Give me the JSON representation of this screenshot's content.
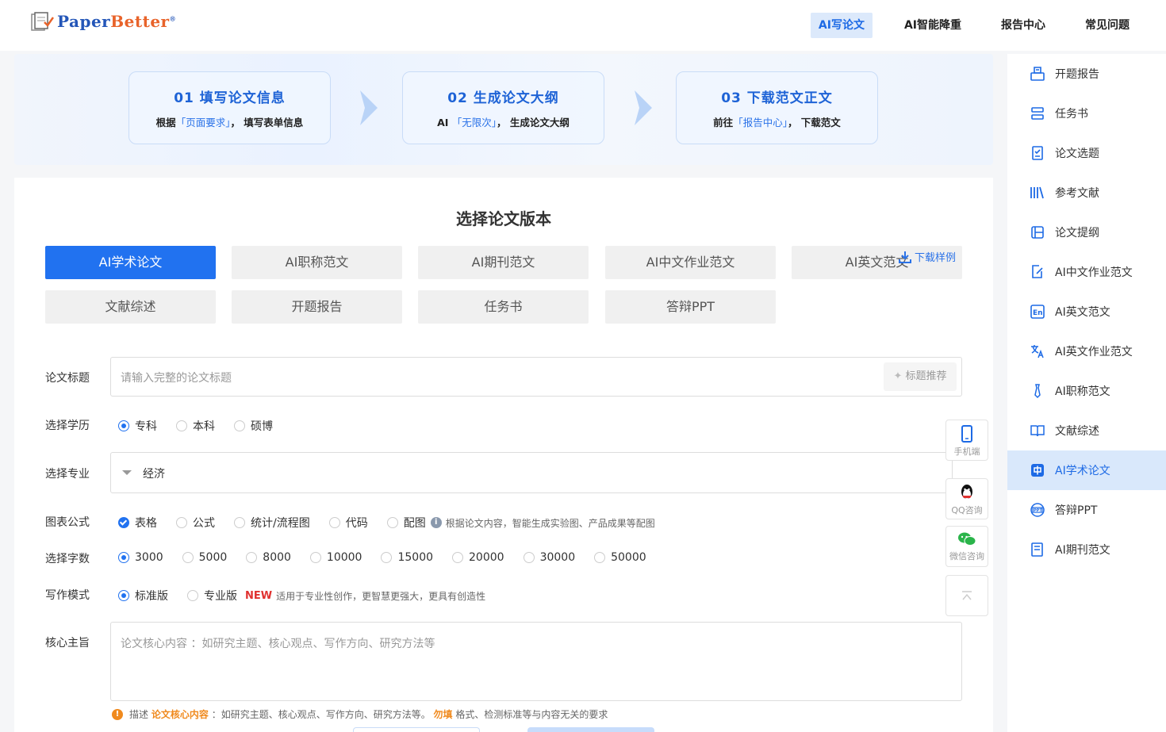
{
  "brand": {
    "name_a": "Paper",
    "name_b": "Better",
    "mark": "®"
  },
  "nav": [
    "AI写论文",
    "AI智能降重",
    "报告中心",
    "常见问题"
  ],
  "steps": [
    {
      "title": "01  填写论文信息",
      "pre": "根据",
      "hl": "「页面要求」",
      "post": "，  填写表单信息"
    },
    {
      "title": "02  生成论文大纲",
      "pre": "AI ",
      "hl": "「无限次」",
      "post": "，  生成论文大纲"
    },
    {
      "title": "03  下载范文正文",
      "pre": "前往",
      "hl": "「报告中心」",
      "post": "，  下载范文"
    }
  ],
  "section_title": "选择论文版本",
  "versions": [
    "AI学术论文",
    "AI职称范文",
    "AI期刊范文",
    "AI中文作业范文",
    "AI英文范文",
    "文献综述",
    "开题报告",
    "任务书",
    "答辩PPT"
  ],
  "download_sample": "下载样例",
  "form": {
    "title_label": "论文标题",
    "title_placeholder": "请输入完整的论文标题",
    "title_suggest": "标题推荐",
    "edu_label": "选择学历",
    "edu_options": [
      "专科",
      "本科",
      "硕博"
    ],
    "major_label": "选择专业",
    "major_value": "经济",
    "chart_label": "图表公式",
    "chart_options": [
      "表格",
      "公式",
      "统计/流程图",
      "代码",
      "配图"
    ],
    "chart_hint": "根据论文内容，智能生成实验图、产品成果等配图",
    "words_label": "选择字数",
    "words_options": [
      "3000",
      "5000",
      "8000",
      "10000",
      "15000",
      "20000",
      "30000",
      "50000"
    ],
    "mode_label": "写作模式",
    "mode_options": [
      "标准版",
      "专业版"
    ],
    "mode_new": "NEW",
    "mode_hint": "适用于专业性创作，更智慧更强大，更具有创造性",
    "core_label": "核心主旨",
    "core_placeholder": "论文核心内容 ：如研究主题、核心观点、写作方向、研究方法等",
    "note_a": "描述",
    "note_b": "论文核心内容",
    "note_c": "：如研究主题、核心观点、写作方向、研究方法等。",
    "note_d": "勿填",
    "note_e": "格式、检测标准等与内容无关的要求"
  },
  "float": {
    "mobile": "手机端",
    "qq": "QQ咨询",
    "wechat": "微信咨询"
  },
  "sidebar": [
    "开题报告",
    "任务书",
    "论文选题",
    "参考文献",
    "论文提纲",
    "AI中文作业范文",
    "AI英文范文",
    "AI英文作业范文",
    "AI职称范文",
    "文献综述",
    "AI学术论文",
    "答辩PPT",
    "AI期刊范文"
  ],
  "colors": {
    "primary": "#2172f0",
    "accent": "#e0312f",
    "orange": "#f08a1e"
  }
}
